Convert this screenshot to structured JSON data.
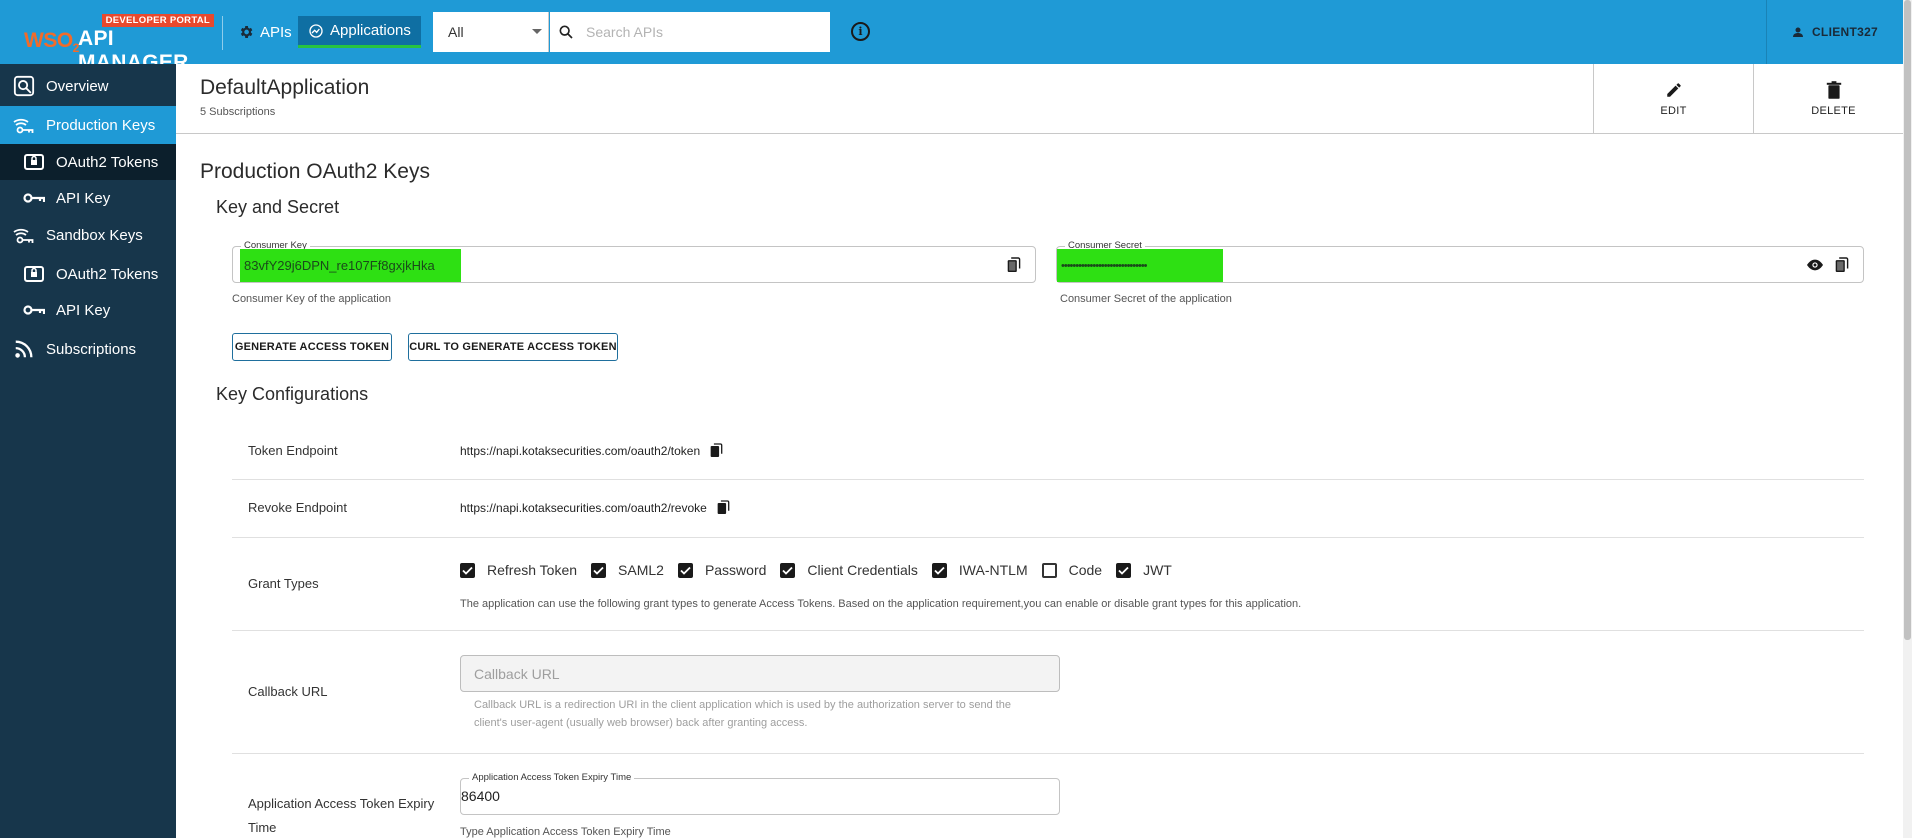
{
  "header": {
    "brand_badge": "DEVELOPER PORTAL",
    "brand_wso2": "WSO",
    "brand_wso2_sub": "2",
    "brand_name": "API MANAGER",
    "nav_apis": "APIs",
    "nav_applications": "Applications",
    "search_category": "All",
    "search_placeholder": "Search APIs",
    "user": "CLIENT327"
  },
  "sidebar": {
    "items": [
      {
        "label": "Overview",
        "icon": "overview-search-icon"
      },
      {
        "label": "Production Keys",
        "icon": "keys-icon"
      },
      {
        "label": "OAuth2 Tokens",
        "icon": "token-icon"
      },
      {
        "label": "API Key",
        "icon": "key-icon"
      },
      {
        "label": "Sandbox Keys",
        "icon": "keys-icon"
      },
      {
        "label": "OAuth2 Tokens",
        "icon": "token-icon"
      },
      {
        "label": "API Key",
        "icon": "key-icon"
      },
      {
        "label": "Subscriptions",
        "icon": "rss-icon"
      }
    ]
  },
  "app": {
    "title": "DefaultApplication",
    "subscriptions": "5 Subscriptions",
    "edit_label": "EDIT",
    "delete_label": "DELETE"
  },
  "keys": {
    "section_title": "Production OAuth2 Keys",
    "key_secret_title": "Key and Secret",
    "consumer_key_label": "Consumer Key",
    "consumer_key_value": "83vfY29j6DPN_re107Ff8gxjkHka",
    "consumer_key_helper": "Consumer Key of the application",
    "consumer_secret_label": "Consumer Secret",
    "consumer_secret_value": "••••••••••••••••••••••••••••••",
    "consumer_secret_helper": "Consumer Secret of the application",
    "generate_btn": "GENERATE ACCESS TOKEN",
    "curl_btn": "CURL TO GENERATE ACCESS TOKEN"
  },
  "config": {
    "title": "Key Configurations",
    "token_endpoint_label": "Token Endpoint",
    "token_endpoint_value": "https://napi.kotaksecurities.com/oauth2/token",
    "revoke_endpoint_label": "Revoke Endpoint",
    "revoke_endpoint_value": "https://napi.kotaksecurities.com/oauth2/revoke",
    "grant_types_label": "Grant Types",
    "grant_types": [
      {
        "label": "Refresh Token",
        "checked": true
      },
      {
        "label": "SAML2",
        "checked": true
      },
      {
        "label": "Password",
        "checked": true
      },
      {
        "label": "Client Credentials",
        "checked": true
      },
      {
        "label": "IWA-NTLM",
        "checked": true
      },
      {
        "label": "Code",
        "checked": false
      },
      {
        "label": "JWT",
        "checked": true
      }
    ],
    "grant_types_helper": "The application can use the following grant types to generate Access Tokens. Based on the application requirement,you can enable or disable grant types for this application.",
    "callback_label": "Callback URL",
    "callback_placeholder": "Callback URL",
    "callback_helper_1": "Callback URL is a redirection URI in the client application which is used by the authorization server to send the",
    "callback_helper_2": "client's user-agent (usually web browser) back after granting access.",
    "expiry_label_1": "Application Access Token Expiry",
    "expiry_label_2": "Time",
    "expiry_field_label": "Application Access Token Expiry Time",
    "expiry_value": "86400",
    "expiry_helper": "Type Application Access Token Expiry Time"
  },
  "colors": {
    "topbar": "#1f9ad6",
    "sidebar": "#17364b",
    "highlight": "#2ee013"
  }
}
